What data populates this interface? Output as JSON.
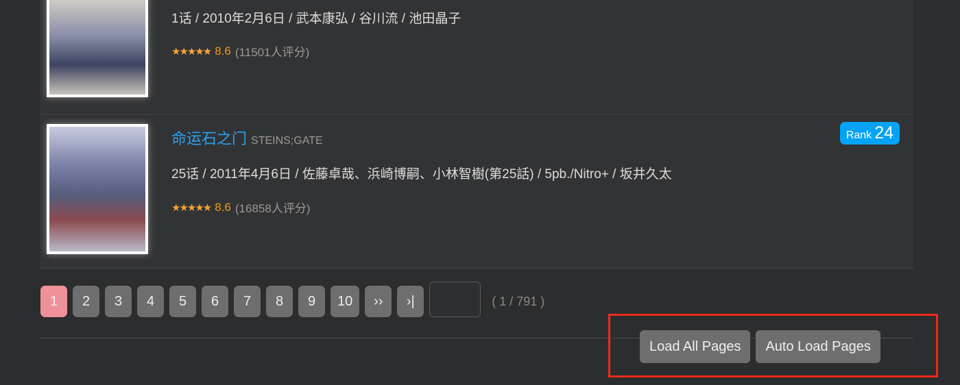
{
  "items": [
    {
      "info": "1话 / 2010年2月6日 / 武本康弘 / 谷川流 / 池田晶子",
      "stars": "★★★★★",
      "score": "8.6",
      "votes": "(11501人评分)"
    },
    {
      "title": "命运石之门",
      "subtitle": "STEINS;GATE",
      "rank_label": "Rank",
      "rank": "24",
      "info": "25话 / 2011年4月6日 / 佐藤卓哉、浜崎博嗣、小林智樹(第25話) / 5pb./Nitro+ / 坂井久太",
      "stars": "★★★★★",
      "score": "8.6",
      "votes": "(16858人评分)"
    }
  ],
  "pager": {
    "pages": [
      "1",
      "2",
      "3",
      "4",
      "5",
      "6",
      "7",
      "8",
      "9",
      "10"
    ],
    "current": "1",
    "next": "››",
    "last": "›|",
    "input_value": "",
    "count": "( 1 / 791 )"
  },
  "buttons": {
    "load_all": "Load All Pages",
    "auto_load": "Auto Load Pages"
  },
  "colors": {
    "accent": "#2aa3f0",
    "rank_badge": "#05a3f5",
    "active_page": "#ef9199",
    "highlight": "#f02a1a"
  }
}
